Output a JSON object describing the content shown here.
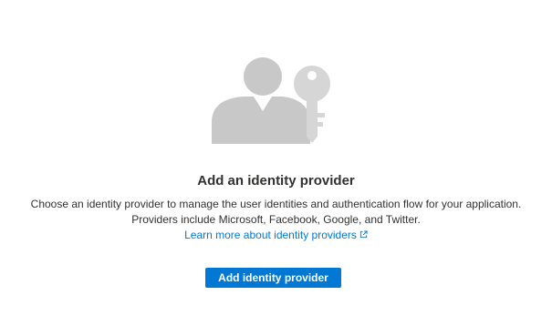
{
  "empty_state": {
    "illustration_icon": "user-with-key-icon",
    "title": "Add an identity provider",
    "description_line1": "Choose an identity provider to manage the user identities and authentication flow for your application.",
    "description_line2": "Providers include Microsoft, Facebook, Google, and Twitter.",
    "learn_more_link": "Learn more about identity providers",
    "learn_more_icon": "external-link-icon",
    "button_label": "Add identity provider"
  },
  "colors": {
    "accent": "#0078d4",
    "text": "#323130",
    "illustration": "#c8c8c8"
  }
}
